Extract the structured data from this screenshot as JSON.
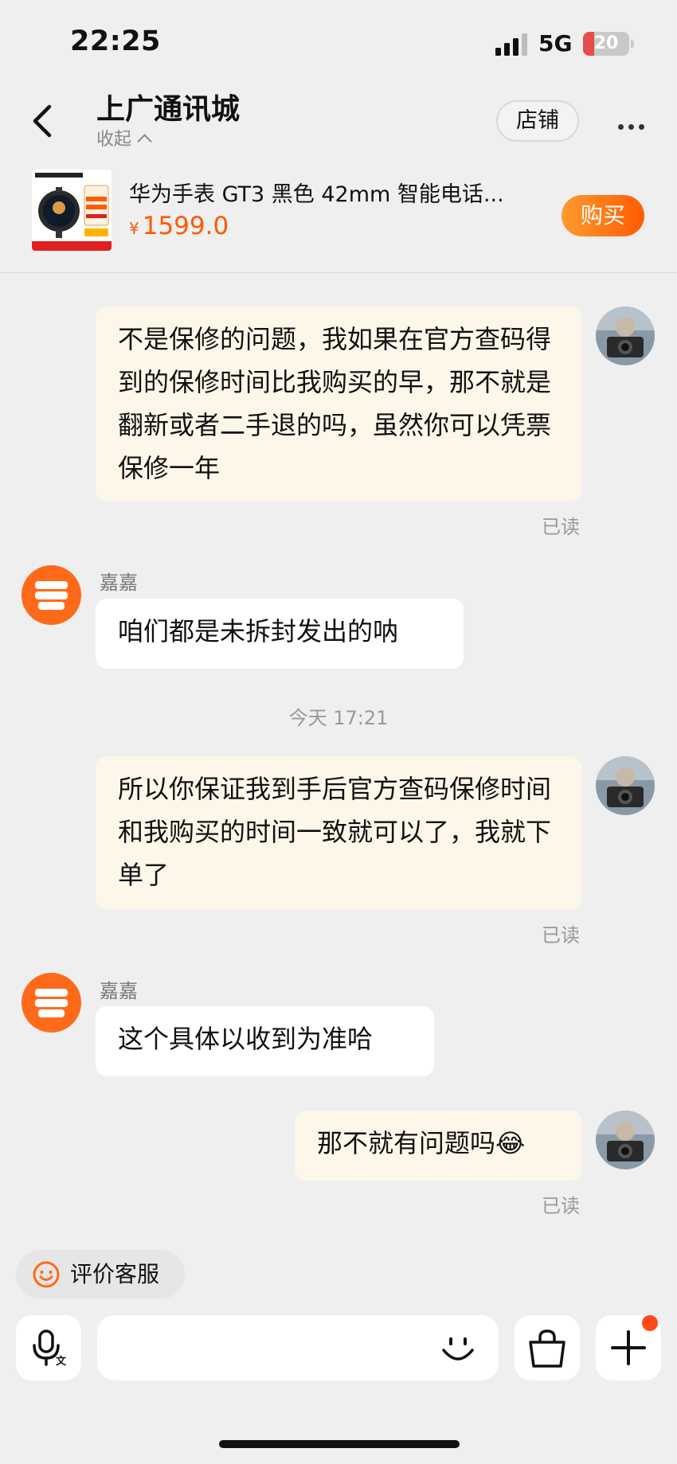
{
  "status_bar": {
    "time": "22:25",
    "network": "5G",
    "battery": "20"
  },
  "header": {
    "shop_name": "上广通讯城",
    "collapse_label": "收起",
    "store_button": "店铺"
  },
  "product": {
    "title": "华为手表 GT3 黑色 42mm 智能电话...",
    "currency": "¥",
    "price": "1599.0",
    "buy_label": "购买"
  },
  "messages": [
    {
      "from": "me",
      "text": "不是保修的问题，我如果在官方查码得到的保修时间比我购买的早，那不就是翻新或者二手退的吗，虽然你可以凭票保修一年",
      "status": "已读"
    },
    {
      "from": "shop",
      "sender": "嘉嘉",
      "text": "咱们都是未拆封发出的呐"
    },
    {
      "type": "timestamp",
      "text": "今天 17:21"
    },
    {
      "from": "me",
      "text": "所以你保证我到手后官方查码保修时间和我购买的时间一致就可以了，我就下单了",
      "status": "已读"
    },
    {
      "from": "shop",
      "sender": "嘉嘉",
      "text": "这个具体以收到为准哈"
    },
    {
      "from": "me",
      "text": "那不就有问题吗😂",
      "status": "已读"
    }
  ],
  "footer": {
    "rate_label": "评价客服",
    "input_placeholder": ""
  },
  "colors": {
    "accent": "#ff5a00",
    "my_bubble": "#fdf7ea",
    "shop_avatar": "#ff6a1a"
  }
}
